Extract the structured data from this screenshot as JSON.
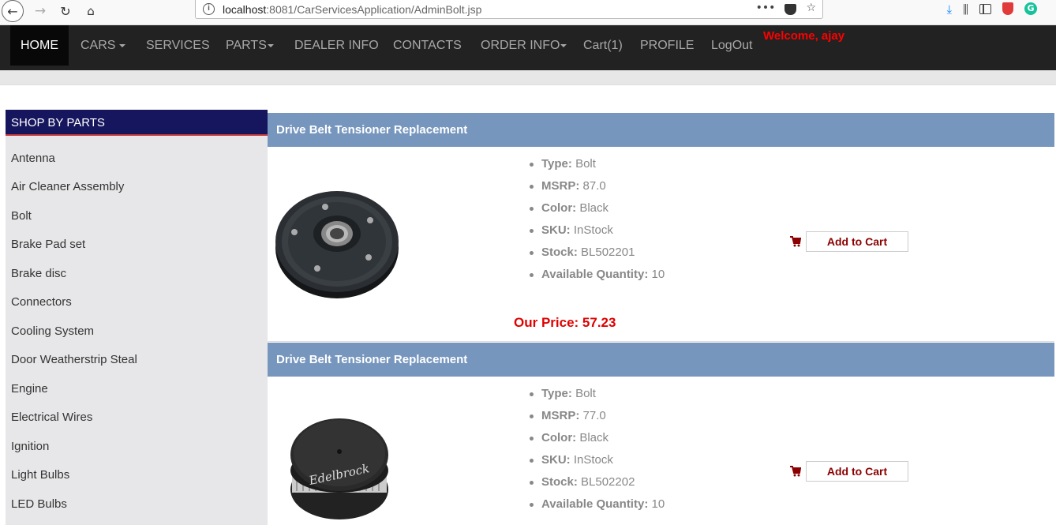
{
  "browser": {
    "url_host": "localhost",
    "url_rest": ":8081/CarServicesApplication/AdminBolt.jsp",
    "url_more": "•••"
  },
  "navbar": {
    "items": [
      {
        "label": "HOME",
        "caret": false
      },
      {
        "label": "CARS",
        "caret": true
      },
      {
        "label": "SERVICES",
        "caret": false
      },
      {
        "label": "PARTS",
        "caret": true
      },
      {
        "label": "DEALER INFO",
        "caret": false
      },
      {
        "label": "CONTACTS",
        "caret": false
      },
      {
        "label": "ORDER INFO",
        "caret": true
      },
      {
        "label": "Cart(1)",
        "caret": false
      },
      {
        "label": "PROFILE",
        "caret": false
      },
      {
        "label": "LogOut",
        "caret": false
      }
    ],
    "welcome": "Welcome, ajay"
  },
  "sidebar": {
    "title": "SHOP BY PARTS",
    "items": [
      "Antenna",
      "Air Cleaner Assembly",
      "Bolt",
      "Brake Pad set",
      "Brake disc",
      "Connectors",
      "Cooling System",
      "Door Weatherstrip Steal",
      "Engine",
      "Electrical Wires",
      "Ignition",
      "Light Bulbs",
      "LED Bulbs"
    ]
  },
  "products": [
    {
      "title": "Drive Belt Tensioner Replacement",
      "specs": [
        {
          "label": "Type:",
          "value": "Bolt"
        },
        {
          "label": "MSRP:",
          "value": "87.0"
        },
        {
          "label": "Color:",
          "value": "Black"
        },
        {
          "label": "SKU:",
          "value": "InStock"
        },
        {
          "label": "Stock:",
          "value": "BL502201"
        },
        {
          "label": "Available Quantity:",
          "value": "10"
        }
      ],
      "cart_label": "Add to Cart",
      "price": "Our Price: 57.23"
    },
    {
      "title": "Drive Belt Tensioner Replacement",
      "specs": [
        {
          "label": "Type:",
          "value": "Bolt"
        },
        {
          "label": "MSRP:",
          "value": "77.0"
        },
        {
          "label": "Color:",
          "value": "Black"
        },
        {
          "label": "SKU:",
          "value": "InStock"
        },
        {
          "label": "Stock:",
          "value": "BL502202"
        },
        {
          "label": "Available Quantity:",
          "value": "10"
        }
      ],
      "cart_label": "Add to Cart",
      "image_text": "Edelbrock"
    }
  ]
}
